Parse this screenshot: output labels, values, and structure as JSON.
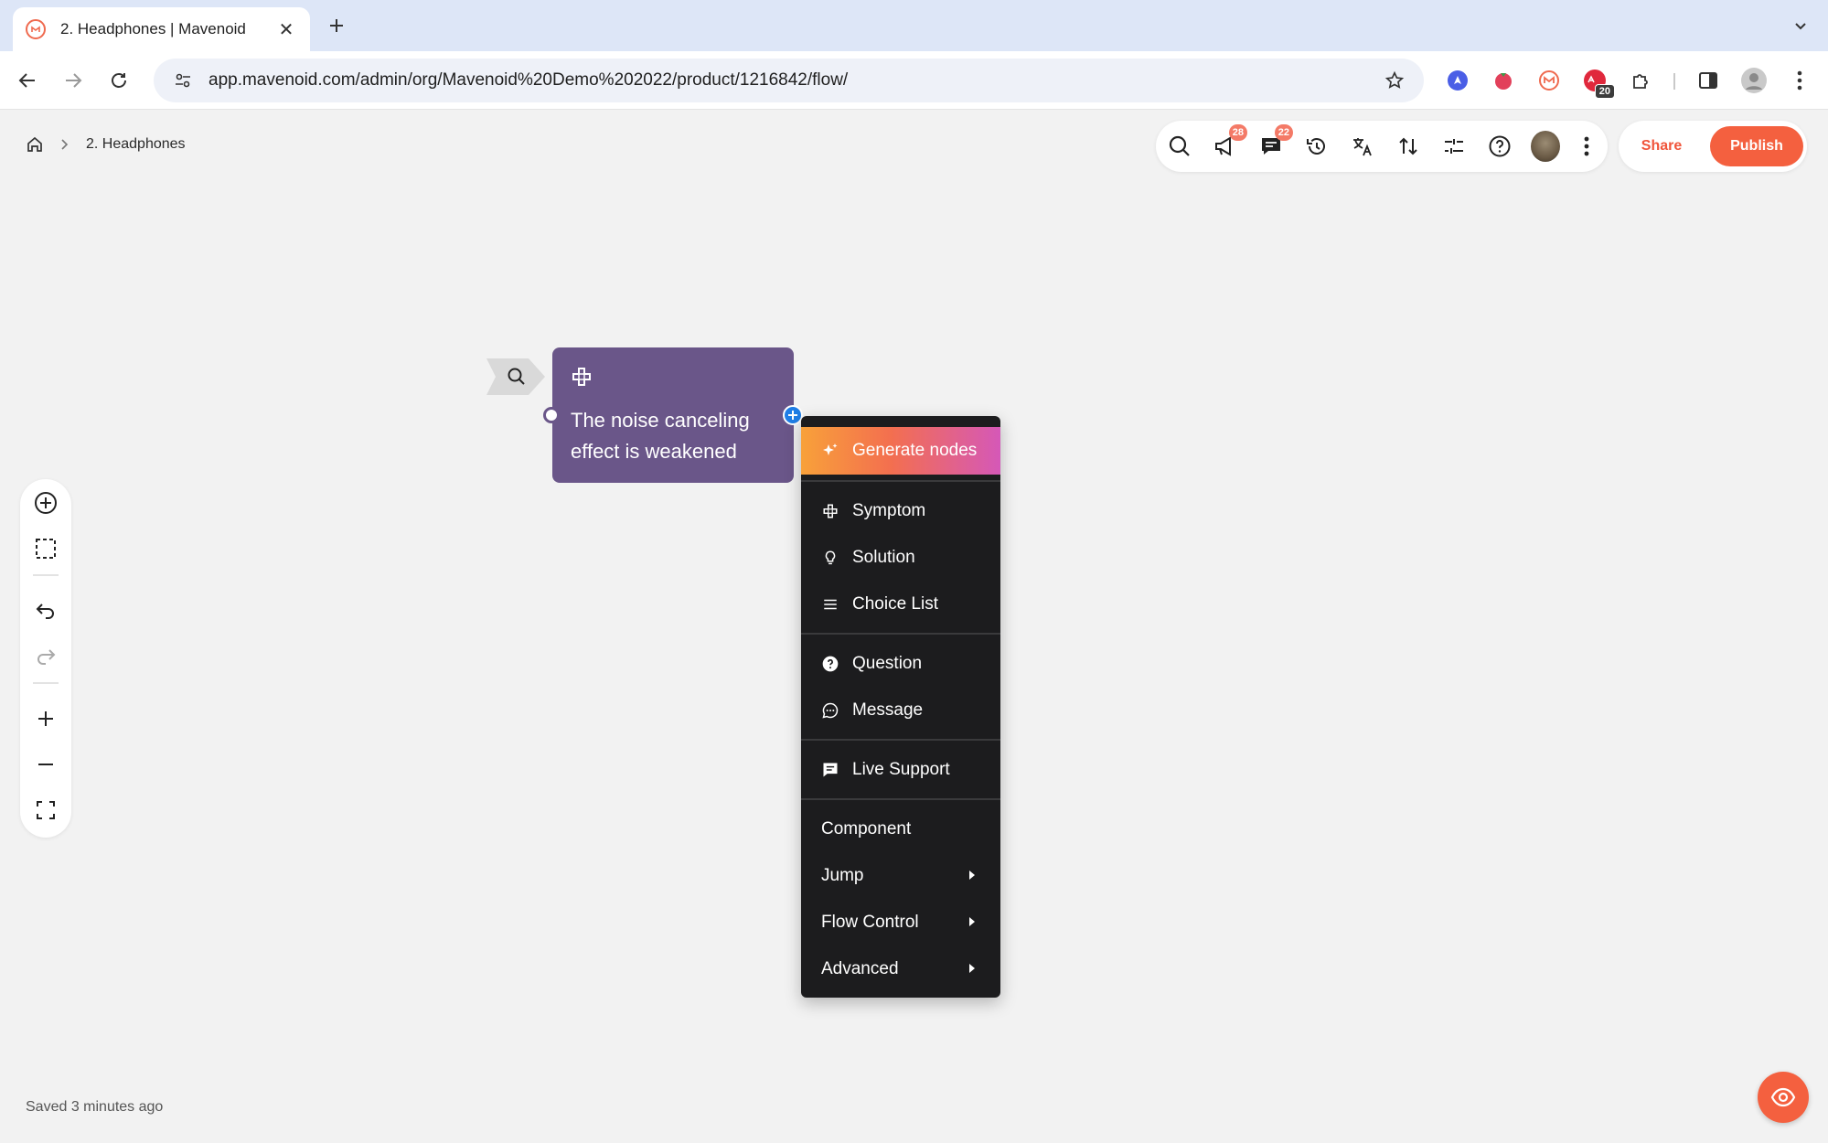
{
  "browser": {
    "tab_title": "2. Headphones | Mavenoid",
    "tab_close": "✕",
    "new_tab": "+",
    "url": "app.mavenoid.com/admin/org/Mavenoid%20Demo%202022/product/1216842/flow/",
    "extension_badge": "20"
  },
  "breadcrumb": {
    "current": "2. Headphones"
  },
  "app_toolbar": {
    "announcements_count": "28",
    "comments_count": "22"
  },
  "actions": {
    "share_label": "Share",
    "publish_label": "Publish"
  },
  "node": {
    "text": "The noise canceling effect is weakened"
  },
  "menu": {
    "generate_label": "Generate nodes",
    "items": [
      {
        "label": "Symptom"
      },
      {
        "label": "Solution"
      },
      {
        "label": "Choice List"
      },
      {
        "label": "Question"
      },
      {
        "label": "Message"
      },
      {
        "label": "Live Support"
      },
      {
        "label": "Component"
      },
      {
        "label": "Jump"
      },
      {
        "label": "Flow Control"
      },
      {
        "label": "Advanced"
      }
    ]
  },
  "status": {
    "saved_text": "Saved 3 minutes ago"
  },
  "colors": {
    "accent": "#f4603f",
    "node": "#6a5689",
    "menu_bg": "#1c1c1e",
    "connector": "#1f7ee6"
  }
}
